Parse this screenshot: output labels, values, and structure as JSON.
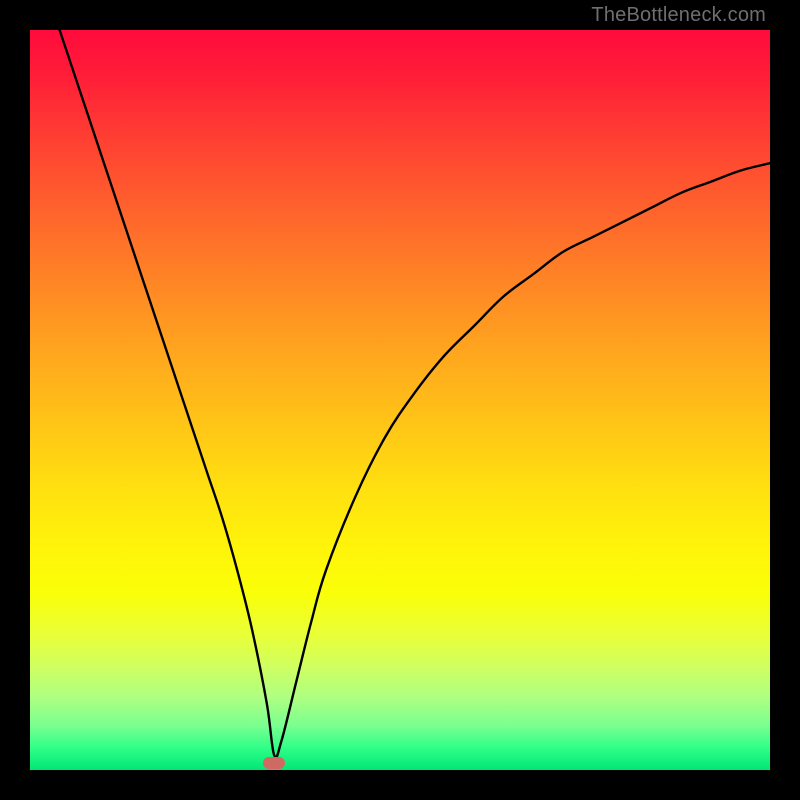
{
  "watermark": "TheBottleneck.com",
  "chart_data": {
    "type": "line",
    "title": "",
    "xlabel": "",
    "ylabel": "",
    "xlim": [
      0,
      100
    ],
    "ylim": [
      0,
      100
    ],
    "grid": false,
    "legend": false,
    "series": [
      {
        "name": "curve",
        "x": [
          4,
          6,
          8,
          10,
          12,
          14,
          16,
          18,
          20,
          22,
          24,
          26,
          28,
          30,
          32,
          33,
          34,
          36,
          38,
          40,
          44,
          48,
          52,
          56,
          60,
          64,
          68,
          72,
          76,
          80,
          84,
          88,
          92,
          96,
          100
        ],
        "y": [
          100,
          94,
          88,
          82,
          76,
          70,
          64,
          58,
          52,
          46,
          40,
          34,
          27,
          19,
          9,
          2,
          4,
          12,
          20,
          27,
          37,
          45,
          51,
          56,
          60,
          64,
          67,
          70,
          72,
          74,
          76,
          78,
          79.5,
          81,
          82
        ]
      }
    ],
    "marker": {
      "x": 33,
      "y": 1
    },
    "colors": {
      "curve": "#000000",
      "marker": "#cf6a63",
      "gradient_top": "#ff0b3c",
      "gradient_bottom": "#00e676"
    }
  }
}
